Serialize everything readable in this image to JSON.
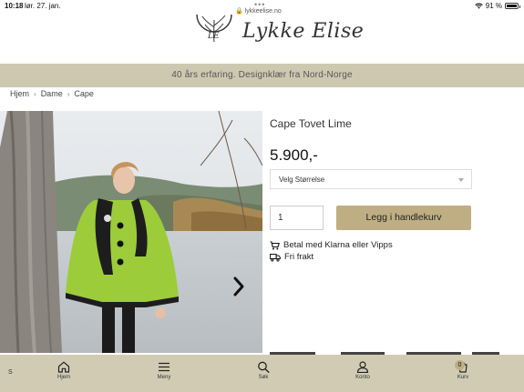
{
  "statusbar": {
    "time": "10:18",
    "date": "lør. 27. jan.",
    "url": "lykkeelise.no",
    "battery": "91 %",
    "battery_level": 0.91
  },
  "brand": {
    "name": "Lykke Elise",
    "mark": "LE"
  },
  "promo": {
    "text": "40 års erfaring. Designklær fra Nord-Norge"
  },
  "breadcrumb": [
    {
      "label": "Hjem"
    },
    {
      "label": "Dame"
    },
    {
      "label": "Cape"
    }
  ],
  "product": {
    "title": "Cape Tovet Lime",
    "price": "5.900,-",
    "size_select": "Velg Størrelse",
    "quantity": "1",
    "add_to_cart": "Legg i handlekurv",
    "features": [
      {
        "icon": "truck-icon",
        "text": "Betal med Klarna eller Vipps"
      },
      {
        "icon": "shipping-icon",
        "text": "Fri frakt"
      }
    ]
  },
  "bottom_nav": {
    "left_letter": "S",
    "items": [
      {
        "label": "Hjem",
        "icon": "home-icon"
      },
      {
        "label": "Meny",
        "icon": "menu-icon"
      },
      {
        "label": "Søk",
        "icon": "search-icon"
      },
      {
        "label": "Konto",
        "icon": "user-icon"
      },
      {
        "label": "Kurv",
        "icon": "cart-icon"
      }
    ],
    "cart_count": "0"
  },
  "colors": {
    "promo_bg": "#cfc8b0",
    "accent": "#bfae84",
    "cape": "#9ccc3a"
  }
}
